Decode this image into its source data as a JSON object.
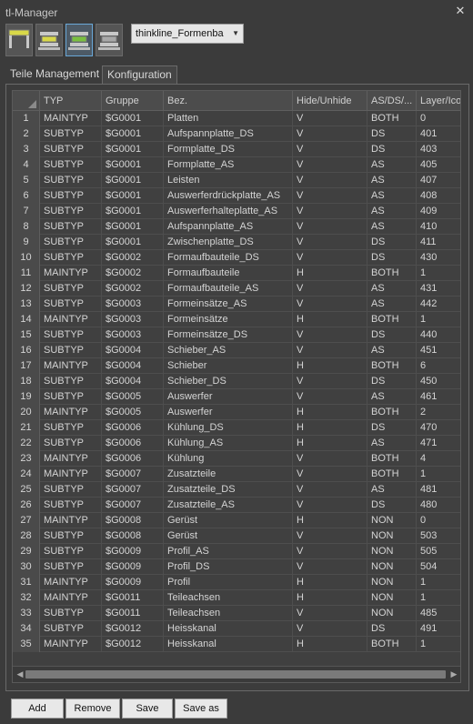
{
  "window": {
    "title": "tl-Manager",
    "close_icon": "close-icon"
  },
  "toolbar": {
    "buttons": [
      {
        "icon": "plate-yellow-icon",
        "selected": false
      },
      {
        "icon": "mold-yellow-icon",
        "selected": false
      },
      {
        "icon": "mold-green-icon",
        "selected": true
      },
      {
        "icon": "mold-grey-icon",
        "selected": false
      }
    ],
    "dropdown_value": "thinkline_Formenba"
  },
  "tabs": [
    {
      "label": "Teile Management",
      "active": false
    },
    {
      "label": "Konfiguration",
      "active": true
    }
  ],
  "table": {
    "columns": [
      "TYP",
      "Gruppe",
      "Bez.",
      "Hide/Unhide",
      "AS/DS/...",
      "Layer/Ico"
    ],
    "rows": [
      [
        "1",
        "MAINTYP",
        "$G0001",
        "Platten",
        "V",
        "BOTH",
        "0"
      ],
      [
        "2",
        "SUBTYP",
        "$G0001",
        "Aufspannplatte_DS",
        "V",
        "DS",
        "401"
      ],
      [
        "3",
        "SUBTYP",
        "$G0001",
        "Formplatte_DS",
        "V",
        "DS",
        "403"
      ],
      [
        "4",
        "SUBTYP",
        "$G0001",
        "Formplatte_AS",
        "V",
        "AS",
        "405"
      ],
      [
        "5",
        "SUBTYP",
        "$G0001",
        "Leisten",
        "V",
        "AS",
        "407"
      ],
      [
        "6",
        "SUBTYP",
        "$G0001",
        "Auswerferdrückplatte_AS",
        "V",
        "AS",
        "408"
      ],
      [
        "7",
        "SUBTYP",
        "$G0001",
        "Auswerferhalteplatte_AS",
        "V",
        "AS",
        "409"
      ],
      [
        "8",
        "SUBTYP",
        "$G0001",
        "Aufspannplatte_AS",
        "V",
        "AS",
        "410"
      ],
      [
        "9",
        "SUBTYP",
        "$G0001",
        "Zwischenplatte_DS",
        "V",
        "DS",
        "411"
      ],
      [
        "10",
        "SUBTYP",
        "$G0002",
        "Formaufbauteile_DS",
        "V",
        "DS",
        "430"
      ],
      [
        "11",
        "MAINTYP",
        "$G0002",
        "Formaufbauteile",
        "H",
        "BOTH",
        "1"
      ],
      [
        "12",
        "SUBTYP",
        "$G0002",
        "Formaufbauteile_AS",
        "V",
        "AS",
        "431"
      ],
      [
        "13",
        "SUBTYP",
        "$G0003",
        "Formeinsätze_AS",
        "V",
        "AS",
        "442"
      ],
      [
        "14",
        "MAINTYP",
        "$G0003",
        "Formeinsätze",
        "H",
        "BOTH",
        "1"
      ],
      [
        "15",
        "SUBTYP",
        "$G0003",
        "Formeinsätze_DS",
        "V",
        "DS",
        "440"
      ],
      [
        "16",
        "SUBTYP",
        "$G0004",
        "Schieber_AS",
        "V",
        "AS",
        "451"
      ],
      [
        "17",
        "MAINTYP",
        "$G0004",
        "Schieber",
        "H",
        "BOTH",
        "6"
      ],
      [
        "18",
        "SUBTYP",
        "$G0004",
        "Schieber_DS",
        "V",
        "DS",
        "450"
      ],
      [
        "19",
        "SUBTYP",
        "$G0005",
        "Auswerfer",
        "V",
        "AS",
        "461"
      ],
      [
        "20",
        "MAINTYP",
        "$G0005",
        "Auswerfer",
        "H",
        "BOTH",
        "2"
      ],
      [
        "21",
        "SUBTYP",
        "$G0006",
        "Kühlung_DS",
        "H",
        "DS",
        "470"
      ],
      [
        "22",
        "SUBTYP",
        "$G0006",
        "Kühlung_AS",
        "H",
        "AS",
        "471"
      ],
      [
        "23",
        "MAINTYP",
        "$G0006",
        "Kühlung",
        "V",
        "BOTH",
        "4"
      ],
      [
        "24",
        "MAINTYP",
        "$G0007",
        "Zusatzteile",
        "V",
        "BOTH",
        "1"
      ],
      [
        "25",
        "SUBTYP",
        "$G0007",
        "Zusatzteile_DS",
        "V",
        "AS",
        "481"
      ],
      [
        "26",
        "SUBTYP",
        "$G0007",
        "Zusatzteile_AS",
        "V",
        "DS",
        "480"
      ],
      [
        "27",
        "MAINTYP",
        "$G0008",
        "Gerüst",
        "H",
        "NON",
        "0"
      ],
      [
        "28",
        "SUBTYP",
        "$G0008",
        "Gerüst",
        "V",
        "NON",
        "503"
      ],
      [
        "29",
        "SUBTYP",
        "$G0009",
        "Profil_AS",
        "V",
        "NON",
        "505"
      ],
      [
        "30",
        "SUBTYP",
        "$G0009",
        "Profil_DS",
        "V",
        "NON",
        "504"
      ],
      [
        "31",
        "MAINTYP",
        "$G0009",
        "Profil",
        "H",
        "NON",
        "1"
      ],
      [
        "32",
        "MAINTYP",
        "$G0011",
        "Teileachsen",
        "H",
        "NON",
        "1"
      ],
      [
        "33",
        "SUBTYP",
        "$G0011",
        "Teileachsen",
        "V",
        "NON",
        "485"
      ],
      [
        "34",
        "SUBTYP",
        "$G0012",
        "Heisskanal",
        "V",
        "DS",
        "491"
      ],
      [
        "35",
        "MAINTYP",
        "$G0012",
        "Heisskanal",
        "H",
        "BOTH",
        "1"
      ]
    ]
  },
  "buttons": {
    "add": "Add",
    "remove": "Remove",
    "save": "Save",
    "save_as": "Save as"
  }
}
